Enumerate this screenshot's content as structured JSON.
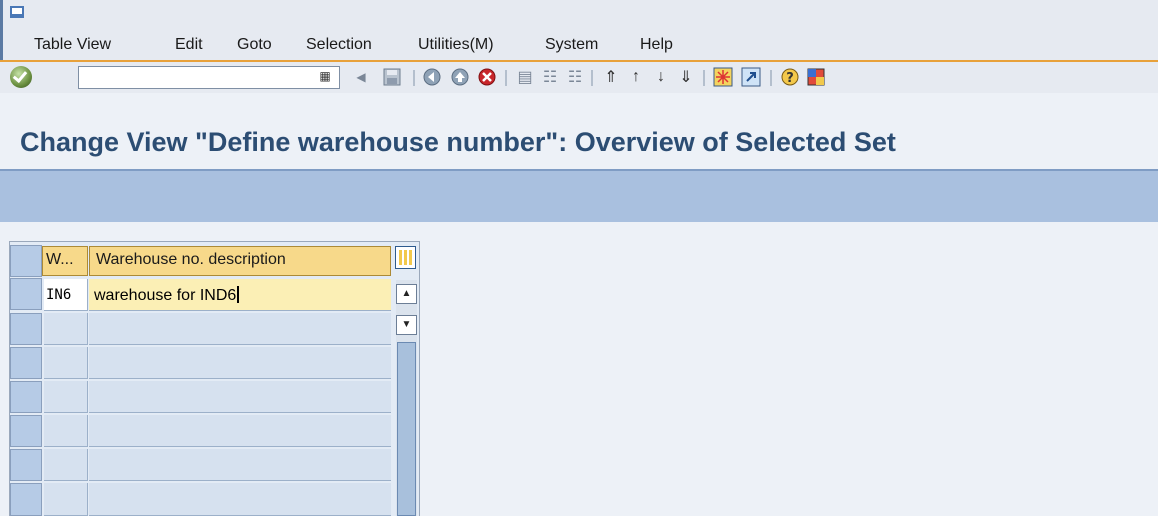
{
  "menu": {
    "items": [
      {
        "label": "Table View"
      },
      {
        "label": "Edit"
      },
      {
        "label": "Goto"
      },
      {
        "label": "Selection"
      },
      {
        "label": "Utilities(M)"
      },
      {
        "label": "System"
      },
      {
        "label": "Help"
      }
    ]
  },
  "toolbar": {
    "command_value": "",
    "icons": [
      "enter-icon",
      "history-dropdown-icon",
      "back-arrow-icon",
      "save-icon",
      "back-icon",
      "exit-icon",
      "cancel-icon",
      "print-icon",
      "find-icon",
      "find-next-icon",
      "first-page-icon",
      "previous-page-icon",
      "next-page-icon",
      "last-page-icon",
      "create-session-icon",
      "create-shortcut-icon",
      "help-icon",
      "customize-layout-icon"
    ]
  },
  "page": {
    "title": "Change View \"Define warehouse number\": Overview of Selected Set"
  },
  "table": {
    "columns": [
      {
        "label": "W..."
      },
      {
        "label": "Warehouse no. description"
      }
    ],
    "rows": [
      {
        "warehouse": "IN6",
        "description": "warehouse for IND6"
      },
      {
        "warehouse": "",
        "description": ""
      },
      {
        "warehouse": "",
        "description": ""
      },
      {
        "warehouse": "",
        "description": ""
      },
      {
        "warehouse": "",
        "description": ""
      },
      {
        "warehouse": "",
        "description": ""
      },
      {
        "warehouse": "",
        "description": ""
      }
    ]
  },
  "colors": {
    "accent_orange": "#e8a13a",
    "title_blue": "#2c4d73",
    "header_yellow": "#f7d98a",
    "app_toolbar_blue": "#a9c0df"
  }
}
